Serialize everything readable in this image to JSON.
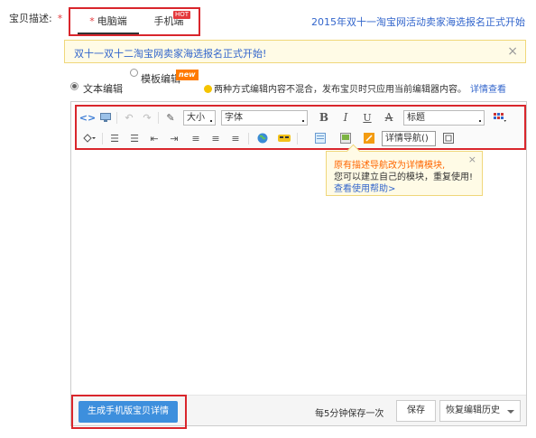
{
  "field": {
    "label": "宝贝描述:",
    "required_mark": "*"
  },
  "platform_tabs": {
    "pc_star": "*",
    "pc_label": "电脑端",
    "mobile_label": "手机端",
    "hot_badge": "HOT"
  },
  "top_link": "2015年双十一淘宝网活动卖家海选报名正式开始",
  "notice": {
    "text": "双十一双十二淘宝网卖家海选报名正式开始!",
    "close": "×"
  },
  "mode": {
    "text_editor": "文本编辑",
    "template_editor": "模板编辑",
    "new_badge": "new",
    "tip": "两种方式编辑内容不混合，发布宝贝时只应用当前编辑器内容。",
    "tip_link": "详情查看"
  },
  "toolbar": {
    "size_select": "大小",
    "font_select": "字体",
    "bold": "B",
    "italic": "I",
    "underline": "U",
    "strike": "A",
    "heading_select": "标题",
    "detail_nav": "详情导航()"
  },
  "popup": {
    "line1": "原有描述导航改为详情模块,",
    "line2": "您可以建立自己的模块，重复使用!",
    "link": "查看使用帮助>",
    "close": "×"
  },
  "footer": {
    "generate_button": "生成手机版宝贝详情",
    "autosave": "每5分钟保存一次",
    "save_button": "保存",
    "restore_button": "恢复编辑历史"
  },
  "colors": {
    "accent_red": "#d9262c",
    "link_blue": "#3366cc",
    "primary_button": "#3d8fdd"
  }
}
